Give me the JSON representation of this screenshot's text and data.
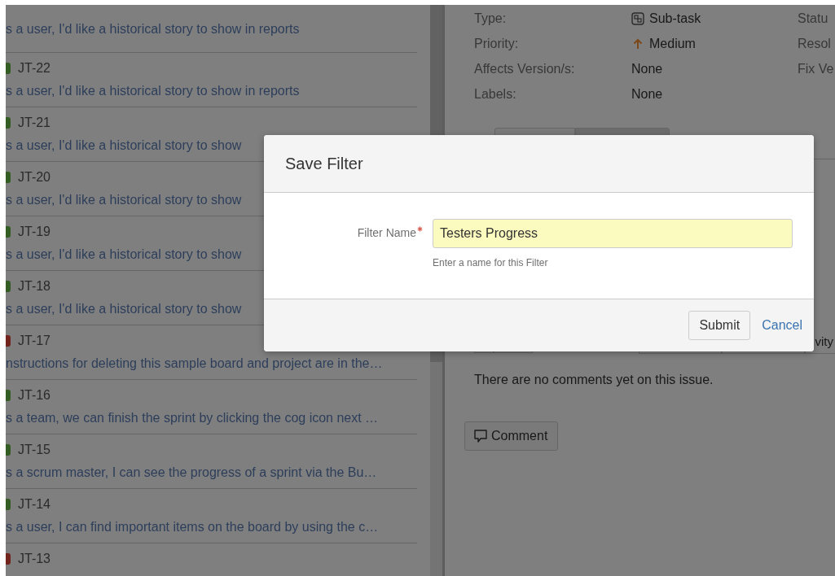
{
  "issue_list": [
    {
      "summary": "s a user, I'd like a historical story to show in reports"
    },
    {
      "key": "JT-22",
      "color": "#335d22",
      "summary": "s a user, I'd like a historical story to show in reports"
    },
    {
      "key": "JT-21",
      "color": "#335d22",
      "summary": "s a user, I'd like a historical story to show"
    },
    {
      "key": "JT-20",
      "color": "#335d22",
      "summary": "s a user, I'd like a historical story to show"
    },
    {
      "key": "JT-19",
      "color": "#335d22",
      "summary": "s a user, I'd like a historical story to show"
    },
    {
      "key": "JT-18",
      "color": "#335d22",
      "summary": "s a user, I'd like a historical story to show"
    },
    {
      "key": "JT-17",
      "color": "#73251d",
      "summary": "nstructions for deleting this sample board and project are in the…"
    },
    {
      "key": "JT-16",
      "color": "#335d22",
      "summary": "s a team, we can finish the sprint by clicking the cog icon next …"
    },
    {
      "key": "JT-15",
      "color": "#335d22",
      "summary": "s a scrum master, I can see the progress of a sprint via the Bu…"
    },
    {
      "key": "JT-14",
      "color": "#335d22",
      "summary": "s a user, I can find important items on the board by using the c…"
    },
    {
      "key": "JT-13",
      "color": "#73251d"
    }
  ],
  "details": {
    "fields": [
      {
        "label": "Type:",
        "value": "Sub-task",
        "kind": "subtask"
      },
      {
        "label": "Priority:",
        "value": "Medium",
        "kind": "priority"
      },
      {
        "label": "Affects Version/s:",
        "value": "None",
        "kind": "plain"
      },
      {
        "label": "Labels:",
        "value": "None",
        "kind": "plain"
      }
    ],
    "side_labels": [
      "Statu",
      "Resol",
      "Fix Ve"
    ]
  },
  "activity_tab": "vity",
  "comments_empty": "There are no comments yet on this issue.",
  "comment_button": "Comment",
  "dialog": {
    "title": "Save Filter",
    "field_label": "Filter Name",
    "required": true,
    "value": "Testers Progress",
    "hint": "Enter a name for this Filter",
    "submit": "Submit",
    "cancel": "Cancel"
  }
}
